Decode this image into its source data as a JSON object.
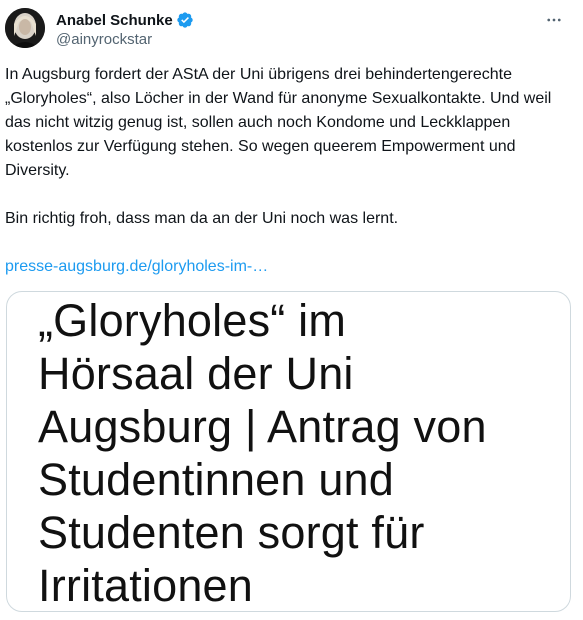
{
  "author": {
    "display_name": "Anabel Schunke",
    "handle": "@ainyrockstar",
    "verified": true
  },
  "colors": {
    "verified_badge": "#1d9bf0",
    "link": "#1d9bf0",
    "secondary_text": "#536471",
    "card_border": "#cfd9de"
  },
  "icons": {
    "more": "more-dots-icon",
    "verified": "verified-badge-icon"
  },
  "tweet": {
    "paragraph1": "In Augsburg fordert der AStA der Uni übrigens drei behindertengerechte „Gloryholes“, also Löcher in der Wand für anonyme Sexualkontakte. Und weil das nicht witzig genug ist, sollen auch noch Kondome und Leckklappen kostenlos zur Verfügung stehen. So wegen queerem Empowerment und Diversity.",
    "paragraph2": "Bin richtig froh, dass man da an der Uni noch was lernt.",
    "link_text": "presse-augsburg.de/gloryholes-im-…"
  },
  "card": {
    "headline_lines": [
      "„Gloryholes“ im",
      "Hörsaal der Uni",
      "Augsburg | Antrag von",
      "Studentinnen und",
      "Studenten sorgt für",
      "Irritationen"
    ]
  }
}
